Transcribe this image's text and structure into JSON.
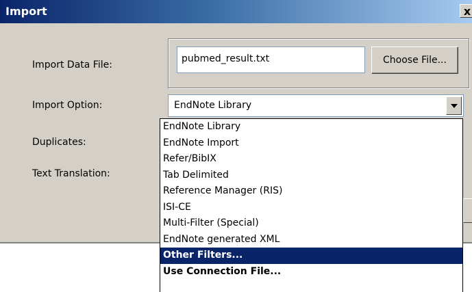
{
  "dialog": {
    "title": "Import",
    "close_label": "x",
    "labels": {
      "import_data_file": "Import Data File:",
      "import_option": "Import Option:",
      "duplicates": "Duplicates:",
      "text_translation": "Text Translation:"
    },
    "file_input": {
      "value": "pubmed_result.txt"
    },
    "choose_file_label": "Choose File...",
    "import_option_select": {
      "selected": "EndNote Library"
    }
  },
  "dropdown": {
    "items": [
      "EndNote Library",
      "EndNote Import",
      "Refer/BibIX",
      "Tab Delimited",
      "Reference Manager (RIS)",
      "ISI-CE",
      "Multi-Filter (Special)",
      "EndNote generated XML",
      "Other Filters...",
      "Use Connection File..."
    ],
    "highlighted": "Other Filters..."
  }
}
